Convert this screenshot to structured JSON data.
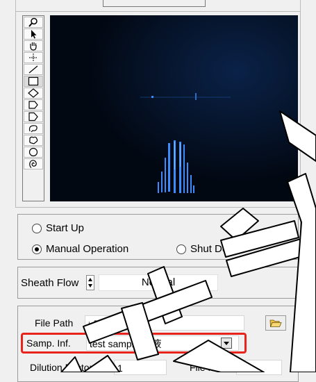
{
  "toolbar": {
    "tools": [
      "zoom-icon",
      "pointer-icon",
      "hand-icon",
      "crosshair-icon",
      "line-icon",
      "rectangle-icon",
      "diamond-icon",
      "pentagon-icon",
      "polygon-icon",
      "lasso-icon",
      "freehand-icon",
      "ellipse-icon",
      "spiral-icon"
    ],
    "active_tool": "rectangle-icon"
  },
  "mode": {
    "start_up": "Start Up",
    "manual_operation": "Manual Operation",
    "shut_down": "Shut Down",
    "selected": "Manual Operation"
  },
  "sheath": {
    "label": "Sheath Flow",
    "value": "Normal"
  },
  "file": {
    "path_label": "File Path",
    "path_value": "D:\\Data",
    "samp_label": "Samp. Inf.",
    "samp_value": "test sample 洗液",
    "dilution_label": "Dilution Factor",
    "dilution_value": "1",
    "file_no_label": "File No.",
    "file_no_value": "5"
  },
  "colors": {
    "highlight": "#e8231c",
    "viewer_bg": "#020812",
    "particle": "#3a8cff"
  }
}
